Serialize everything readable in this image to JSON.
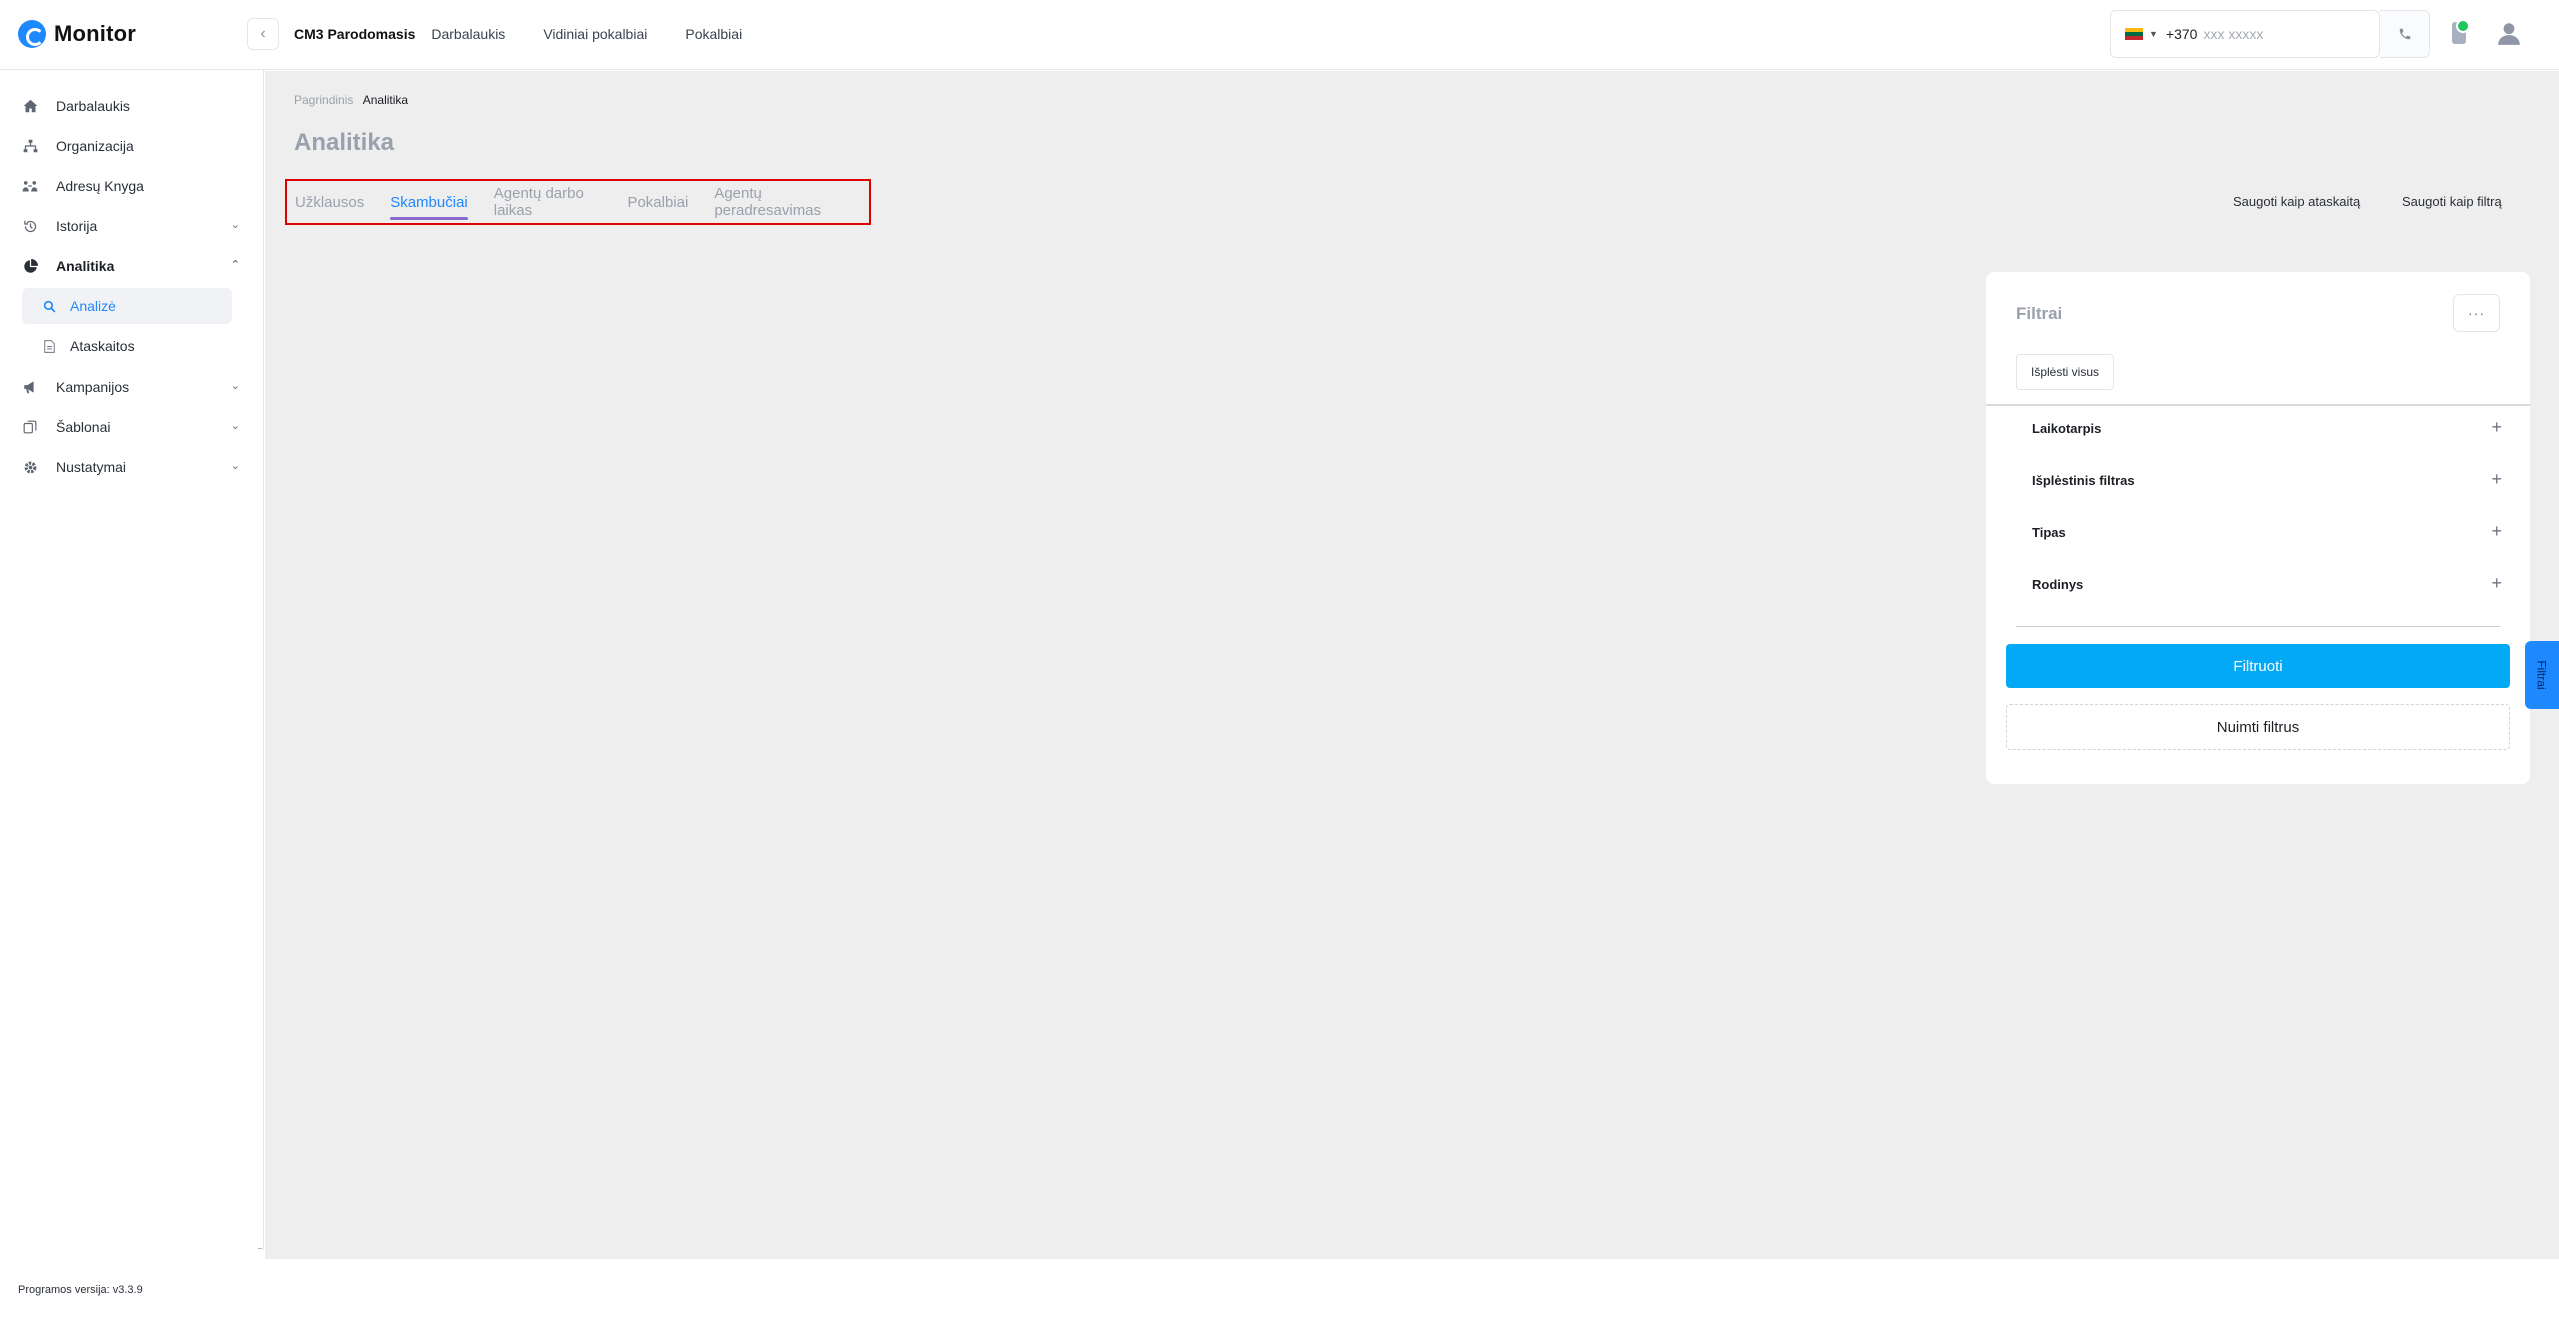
{
  "header": {
    "logo_text": "Monitor",
    "org_name": "CM3 Parodomasis",
    "nav_links": [
      "Darbalaukis",
      "Vidiniai pokalbiai",
      "Pokalbiai"
    ],
    "phone_prefix": "+370",
    "phone_placeholder": "xxx xxxxx",
    "status_color": "#22c55e"
  },
  "sidebar": {
    "items": [
      {
        "label": "Darbalaukis",
        "icon": "home-icon"
      },
      {
        "label": "Organizacija",
        "icon": "org-chart-icon"
      },
      {
        "label": "Adresų Knyga",
        "icon": "address-book-icon"
      },
      {
        "label": "Istorija",
        "icon": "history-icon"
      },
      {
        "label": "Analitika",
        "icon": "pie-chart-icon"
      },
      {
        "label": "Kampanijos",
        "icon": "megaphone-icon"
      },
      {
        "label": "Šablonai",
        "icon": "templates-icon"
      },
      {
        "label": "Nustatymai",
        "icon": "gear-icon"
      }
    ],
    "sub_items": [
      {
        "label": "Analizė",
        "icon": "search-icon"
      },
      {
        "label": "Ataskaitos",
        "icon": "document-icon"
      }
    ],
    "version": "Programos versija: v3.3.9"
  },
  "main": {
    "breadcrumb_root": "Pagrindinis",
    "breadcrumb_current": "Analitika",
    "title": "Analitika",
    "tabs": [
      "Užklausos",
      "Skambučiai",
      "Agentų darbo laikas",
      "Pokalbiai",
      "Agentų peradresavimas"
    ],
    "save_report": "Saugoti kaip ataskaitą",
    "save_filter": "Saugoti kaip filtrą"
  },
  "filters": {
    "title": "Filtrai",
    "more": "···",
    "expand_all": "Išplėsti visus",
    "sections": [
      "Laikotarpis",
      "Išplėstinis filtras",
      "Tipas",
      "Rodinys"
    ],
    "apply": "Filtruoti",
    "clear": "Nuimti filtrus",
    "side_tab": "Filtrai"
  },
  "colors": {
    "accent": "#1e88ff",
    "filter_button": "#03a9f4",
    "highlight_box": "#e00000"
  }
}
